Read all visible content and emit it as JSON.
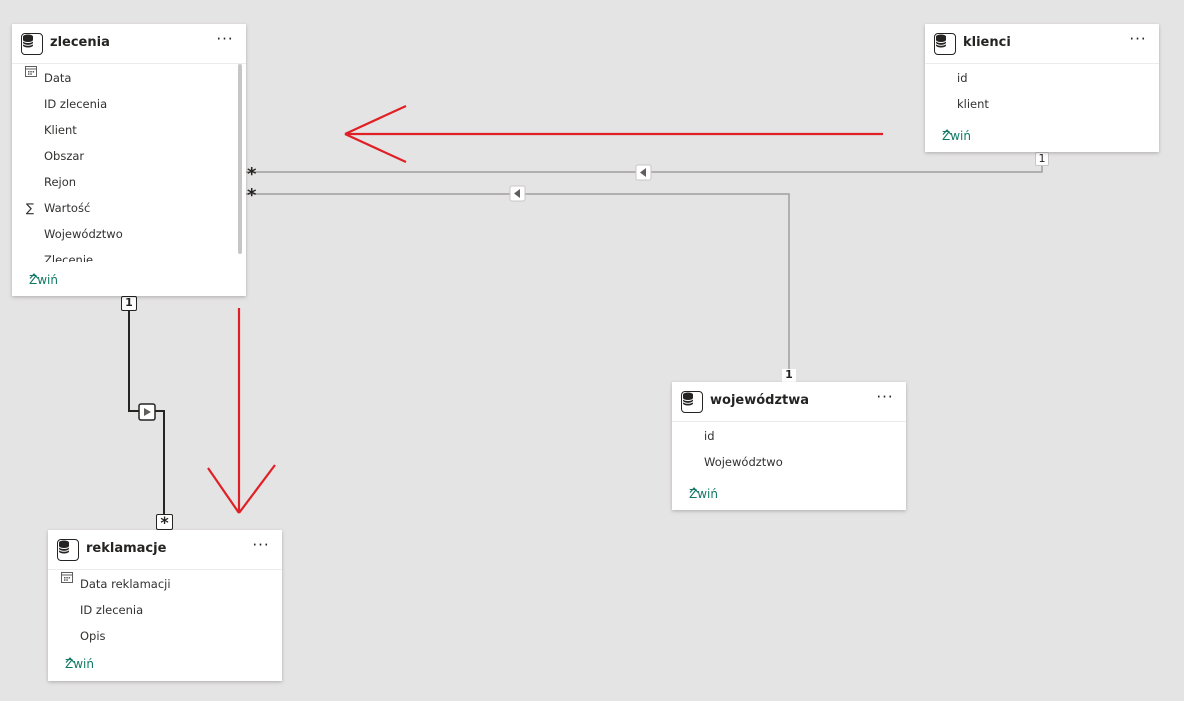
{
  "colors": {
    "canvas_bg": "#e5e4e4",
    "card_bg": "#ffffff",
    "accent_link": "#117865",
    "annotation_red": "#e02027",
    "line_gray": "#a19f9d",
    "line_black": "#252423"
  },
  "tables": {
    "zlecenia": {
      "title": "zlecenia",
      "more": "···",
      "fields": [
        {
          "label": "Data",
          "icon": "calendar-icon"
        },
        {
          "label": "ID zlecenia",
          "icon": ""
        },
        {
          "label": "Klient",
          "icon": ""
        },
        {
          "label": "Obszar",
          "icon": ""
        },
        {
          "label": "Rejon",
          "icon": ""
        },
        {
          "label": "Wartość",
          "icon": "sigma-icon"
        },
        {
          "label": "Województwo",
          "icon": ""
        },
        {
          "label": "Zlecenie",
          "icon": ""
        }
      ],
      "collapse": "Zwiń"
    },
    "klienci": {
      "title": "klienci",
      "more": "···",
      "fields": [
        {
          "label": "id",
          "icon": ""
        },
        {
          "label": "klient",
          "icon": ""
        }
      ],
      "collapse": "Zwiń"
    },
    "wojewodztwa": {
      "title": "województwa",
      "more": "···",
      "fields": [
        {
          "label": "id",
          "icon": ""
        },
        {
          "label": "Województwo",
          "icon": ""
        }
      ],
      "collapse": "Zwiń"
    },
    "reklamacje": {
      "title": "reklamacje",
      "more": "···",
      "fields": [
        {
          "label": "Data reklamacji",
          "icon": "calendar-icon"
        },
        {
          "label": "ID zlecenia",
          "icon": ""
        },
        {
          "label": "Opis",
          "icon": ""
        }
      ],
      "collapse": "Zwiń"
    }
  },
  "relationships": {
    "one": "1",
    "many": "*"
  }
}
